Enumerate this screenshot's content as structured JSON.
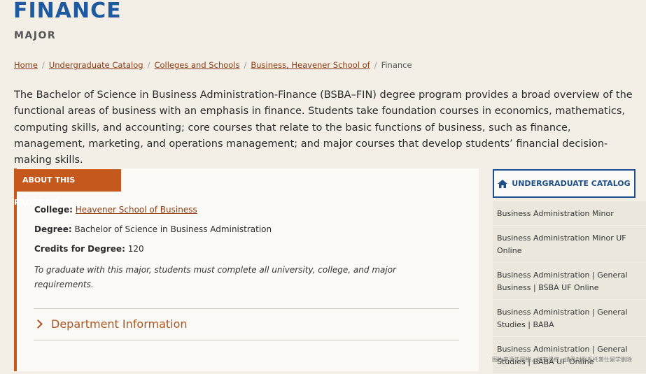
{
  "page": {
    "title": "FINANCE",
    "subtitle": "MAJOR"
  },
  "breadcrumb": {
    "items": [
      "Home",
      "Undergraduate Catalog",
      "Colleges and Schools",
      "Business, Heavener School of"
    ],
    "current": "Finance",
    "separator": "/"
  },
  "intro": "The Bachelor of Science in Business Administration-Finance (BSBA–FIN) degree program provides a broad overview of the functional areas of business with an emphasis in finance. Students take foundation courses in economics, mathematics, computing skills, and accounting; core courses that relate to the basic functions of business, such as finance, management, marketing, and operations management; and major courses that develop students’ financial decision-making skills.",
  "program": {
    "tab_label": "ABOUT THIS PROGRAM",
    "college_label": "College:",
    "college_value": "Heavener School of Business",
    "degree_label": "Degree:",
    "degree_value": "Bachelor of Science in Business Administration",
    "credits_label": "Credits for Degree:",
    "credits_value": "120",
    "note": "To graduate with this major, students must complete all university, college, and major requirements.",
    "accordion_label": "Department Information"
  },
  "sidebar": {
    "catalog_button": "UNDERGRADUATE CATALOG",
    "items": [
      "Business Administration Minor",
      "Business Administration Minor UF Online",
      "Business Administration | General Business | BSBA UF Online",
      "Business Administration | General Studies | BABA",
      "Business Administration | General Studies | BABA UF Online"
    ]
  },
  "watermark": "图片来源于网络，如有侵权，请及时联系托普仕留学删除",
  "colors": {
    "accent": "#c4581d",
    "brand_blue": "#1f5aa0",
    "link": "#8a3b14",
    "background": "#f3efe6"
  },
  "icons": {
    "catalog": "home-icon",
    "accordion": "chevron-right-icon"
  }
}
